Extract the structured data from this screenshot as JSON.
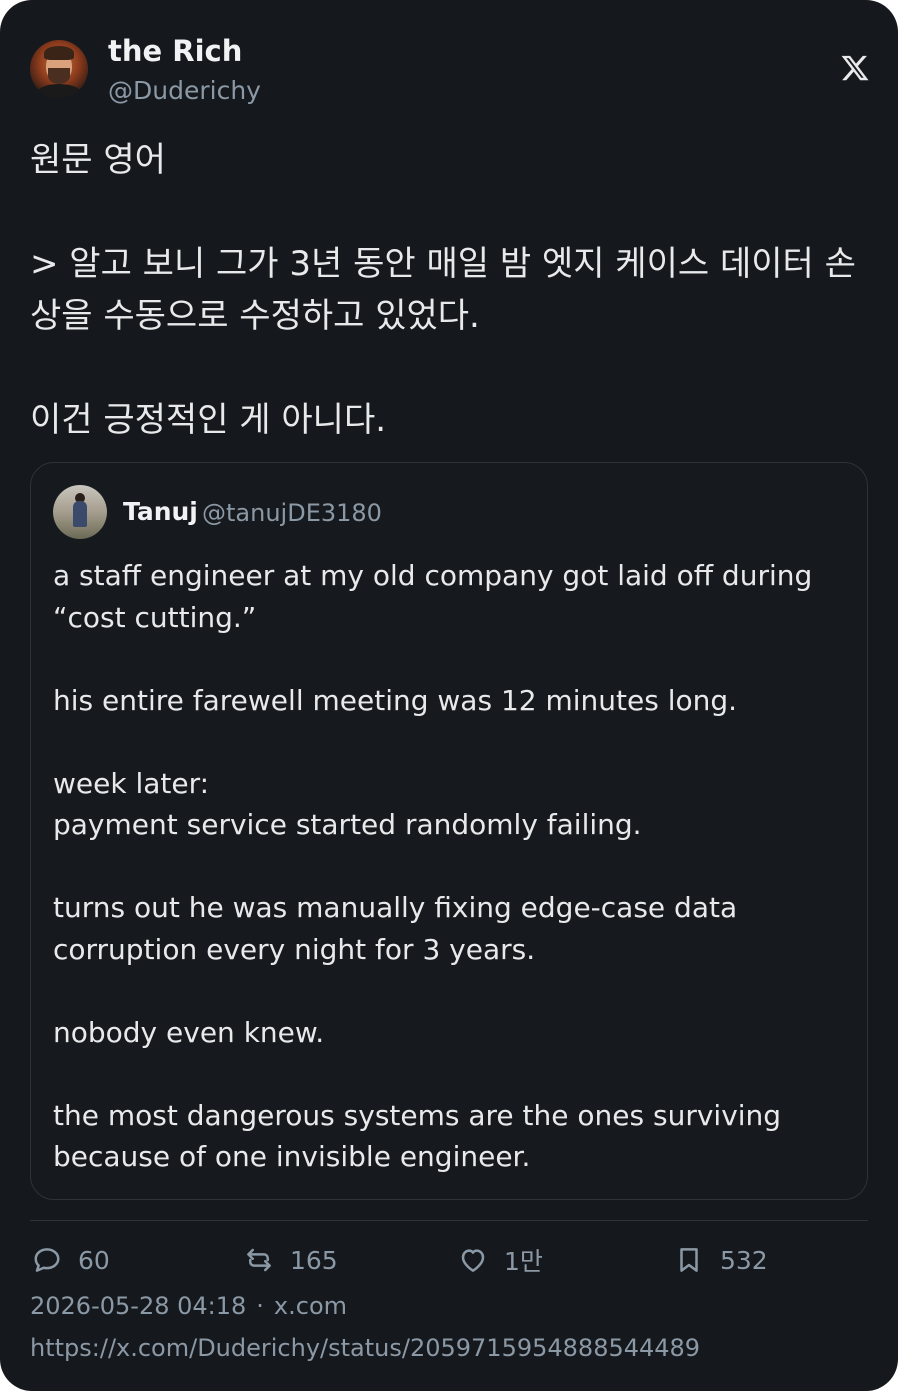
{
  "author": {
    "display_name": "the Rich",
    "handle": "@Duderichy"
  },
  "tweet": {
    "text": "원문 영어\n\n> 알고 보니 그가 3년 동안 매일 밤 엣지 케이스 데이터 손상을 수동으로 수정하고 있었다.\n\n이건 긍정적인 게 아니다."
  },
  "quote": {
    "display_name": "Tanuj",
    "handle": "@tanujDE3180",
    "text": "a staff engineer at my old company got laid off during “cost cutting.”\n\nhis entire farewell meeting was 12 minutes long.\n\nweek later:\npayment service started randomly failing.\n\nturns out he was manually fixing edge-case data corruption every night for 3 years.\n\nnobody even knew.\n\nthe most dangerous systems are the ones surviving because of one invisible engineer."
  },
  "actions": {
    "replies": "60",
    "reposts": "165",
    "likes": "1만",
    "bookmarks": "532"
  },
  "meta": {
    "timestamp": "2026-05-28 04:18",
    "separator": "·",
    "source": "x.com",
    "url": "https://x.com/Duderichy/status/2059715954888544489"
  },
  "icons": {
    "logo": "x-logo-icon",
    "reply": "reply-bubble-icon",
    "repost": "repost-arrows-icon",
    "like": "heart-icon",
    "bookmark": "bookmark-icon"
  },
  "colors": {
    "background": "#15181c",
    "text": "#e7e9ea",
    "muted": "#8b98a5",
    "border": "#2f3336"
  }
}
